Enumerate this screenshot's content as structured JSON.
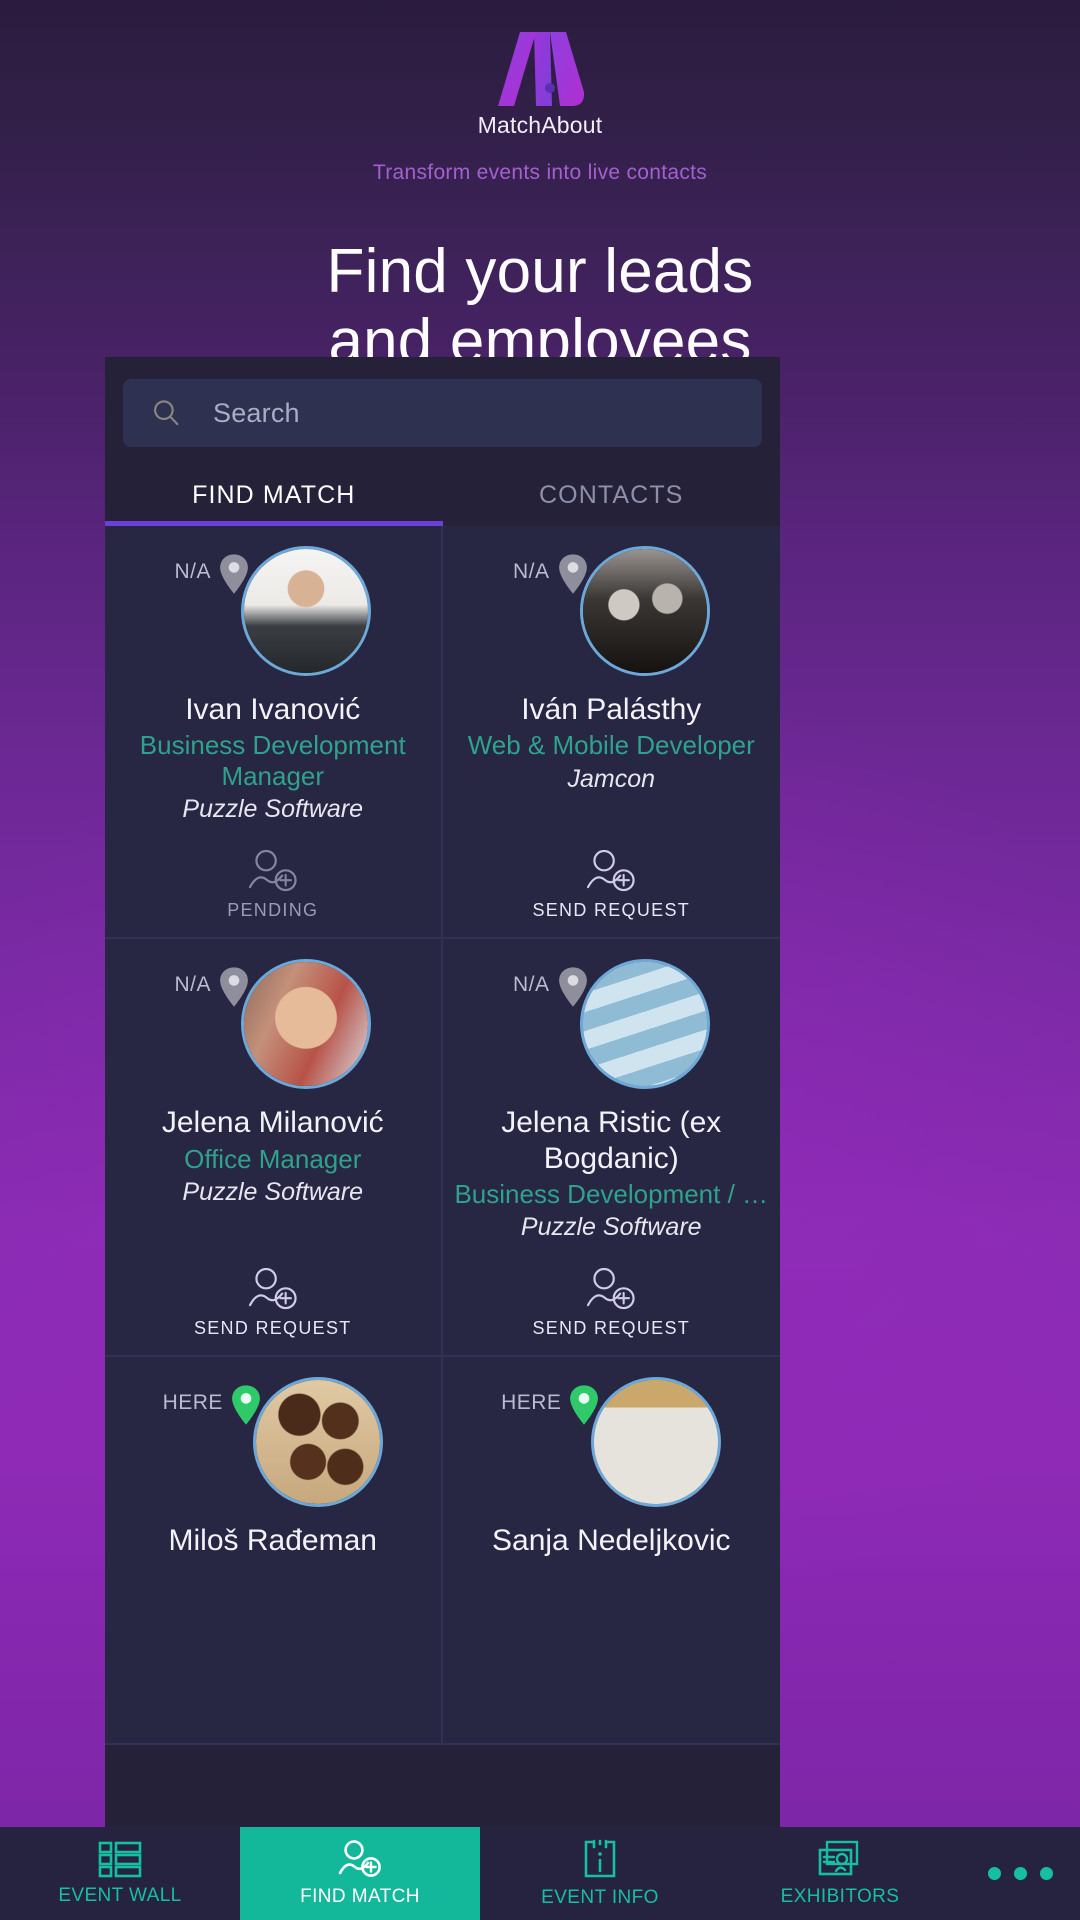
{
  "brand": {
    "logo_icon": "matchabout-m-logo",
    "wordmark": "MatchAbout",
    "tagline": "Transform events into live contacts",
    "logo_gradient_from": "#8f3fe0",
    "logo_gradient_to": "#b536d6"
  },
  "hero": {
    "line1": "Find your leads",
    "line2": "and employees"
  },
  "search": {
    "icon": "search-icon",
    "placeholder": "Search",
    "value": ""
  },
  "tabs": [
    {
      "label": "FIND MATCH",
      "active": true
    },
    {
      "label": "CONTACTS",
      "active": false
    }
  ],
  "tab_accent": "#6a40d8",
  "cards": [
    {
      "distance": "N/A",
      "pin_state": "away",
      "name": "Ivan Ivanović",
      "title": "Business Development Manager",
      "company": "Puzzle Software",
      "action_label": "PENDING",
      "action_state": "pending",
      "action_icon": "add-person-icon",
      "photo": "man-dark-shirt-white-background"
    },
    {
      "distance": "N/A",
      "pin_state": "away",
      "name": "Iván Palásthy",
      "title": "Web & Mobile Developer",
      "company": "Jamcon",
      "action_label": "SEND REQUEST",
      "action_state": "send",
      "action_icon": "add-person-icon",
      "photo": "couple-sunglasses-black-white"
    },
    {
      "distance": "N/A",
      "pin_state": "away",
      "name": "Jelena Milanović",
      "title": "Office Manager",
      "company": "Puzzle Software",
      "action_label": "SEND REQUEST",
      "action_state": "send",
      "action_icon": "add-person-icon",
      "photo": "smiling-woman-portrait"
    },
    {
      "distance": "N/A",
      "pin_state": "away",
      "name": "Jelena Ristic (ex Bogdanic)",
      "title": "Business Development / …",
      "company": "Puzzle Software",
      "action_label": "SEND REQUEST",
      "action_state": "send",
      "action_icon": "add-person-icon",
      "photo": "woman-creative-virtual-world-banner"
    },
    {
      "distance": "HERE",
      "pin_state": "here",
      "name": "Miloš Rađeman",
      "title": "",
      "company": "",
      "action_label": "",
      "action_state": "",
      "action_icon": "",
      "photo": "chocolate-truffles-dessert"
    },
    {
      "distance": "HERE",
      "pin_state": "here",
      "name": "Sanja Nedeljkovic",
      "title": "",
      "company": "",
      "action_label": "",
      "action_state": "",
      "action_icon": "",
      "photo": "woman-on-stairs-green-balloons"
    }
  ],
  "bottom_nav": {
    "items": [
      {
        "label": "EVENT WALL",
        "icon": "grid-list-icon",
        "active": false
      },
      {
        "label": "FIND MATCH",
        "icon": "add-person-icon",
        "active": true
      },
      {
        "label": "EVENT INFO",
        "icon": "info-clipboard-icon",
        "active": false
      },
      {
        "label": "EXHIBITORS",
        "icon": "cards-stack-icon",
        "active": false
      }
    ],
    "more_icon": "more-dots-icon",
    "accent": "#15bfa0"
  }
}
